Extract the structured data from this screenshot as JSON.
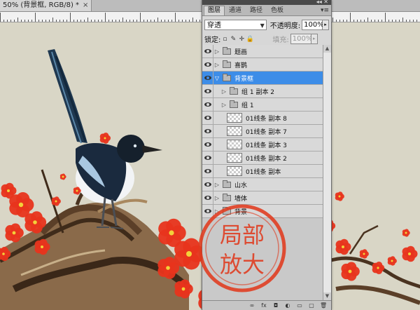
{
  "document": {
    "tab_title": "50% (背景框, RGB/8) *",
    "close_glyph": "×"
  },
  "panel": {
    "tabs": [
      {
        "label": "图层",
        "active": true
      },
      {
        "label": "通道",
        "active": false
      },
      {
        "label": "路径",
        "active": false
      },
      {
        "label": "色板",
        "active": false
      }
    ],
    "menu_glyph": "▾≡",
    "blend_mode": "穿透",
    "opacity_label": "不透明度:",
    "opacity_value": "100%",
    "lock_label": "锁定:",
    "fill_label": "填充:",
    "fill_value": "100%",
    "layers": [
      {
        "name": "题画",
        "type": "group",
        "indent": 0,
        "selected": false,
        "expanded": false
      },
      {
        "name": "喜鹊",
        "type": "group",
        "indent": 0,
        "selected": false,
        "expanded": false
      },
      {
        "name": "背景框",
        "type": "group",
        "indent": 0,
        "selected": true,
        "expanded": true
      },
      {
        "name": "组 1 副本 2",
        "type": "group",
        "indent": 1,
        "selected": false,
        "expanded": false
      },
      {
        "name": "组 1",
        "type": "group",
        "indent": 1,
        "selected": false,
        "expanded": false
      },
      {
        "name": "01线条 副本 8",
        "type": "layer",
        "indent": 2,
        "selected": false
      },
      {
        "name": "01线条 副本 7",
        "type": "layer",
        "indent": 2,
        "selected": false
      },
      {
        "name": "01线条 副本 3",
        "type": "layer",
        "indent": 2,
        "selected": false
      },
      {
        "name": "01线条 副本 2",
        "type": "layer",
        "indent": 2,
        "selected": false
      },
      {
        "name": "01线条 副本",
        "type": "layer",
        "indent": 2,
        "selected": false
      },
      {
        "name": "山水",
        "type": "group",
        "indent": 0,
        "selected": false,
        "expanded": false
      },
      {
        "name": "墙体",
        "type": "group",
        "indent": 0,
        "selected": false,
        "expanded": false
      },
      {
        "name": "背景",
        "type": "group",
        "indent": 0,
        "selected": false,
        "expanded": false
      }
    ],
    "footer_icons": [
      "link-icon",
      "fx-icon",
      "mask-icon",
      "adjustment-icon",
      "new-group-icon",
      "new-layer-icon",
      "trash-icon"
    ],
    "footer_glyphs": [
      "∞",
      "fx",
      "◘",
      "◐",
      "▭",
      "▢",
      "🗑"
    ]
  },
  "stamp": {
    "text_line1": "局部",
    "text_line2": "放大",
    "color": "#e03a1e"
  },
  "colors": {
    "selection": "#3d8de8",
    "canvas_bg": "#d9d6c6",
    "blossom": "#e8341c"
  }
}
